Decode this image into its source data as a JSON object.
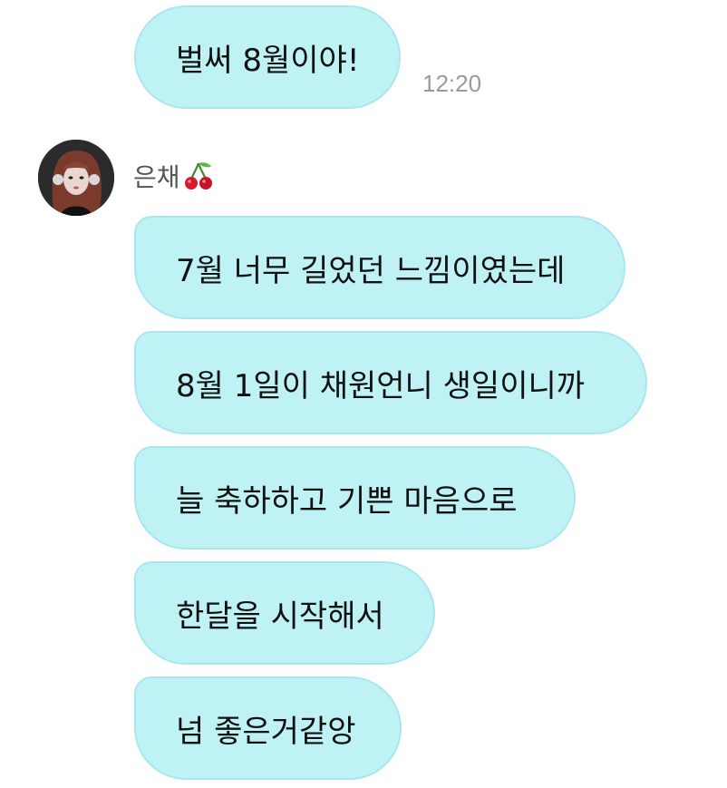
{
  "chat": {
    "first_message": {
      "text": "벌써 8월이야!",
      "time": "12:20"
    },
    "sender": {
      "name": "은채",
      "emoji_icon": "cherry-icon"
    },
    "messages": [
      {
        "text": "7월 너무 길었던 느낌이였는데"
      },
      {
        "text": "8월 1일이 채원언니 생일이니까"
      },
      {
        "text": "늘 축하하고 기쁜 마음으로"
      },
      {
        "text": "한달을 시작해서"
      },
      {
        "text": "넘 좋은거같앙"
      }
    ]
  },
  "colors": {
    "bubble": "#bff2f5",
    "bubble_border": "#a9e7ee",
    "timestamp": "#9a9a9a",
    "sender_name": "#555555"
  }
}
